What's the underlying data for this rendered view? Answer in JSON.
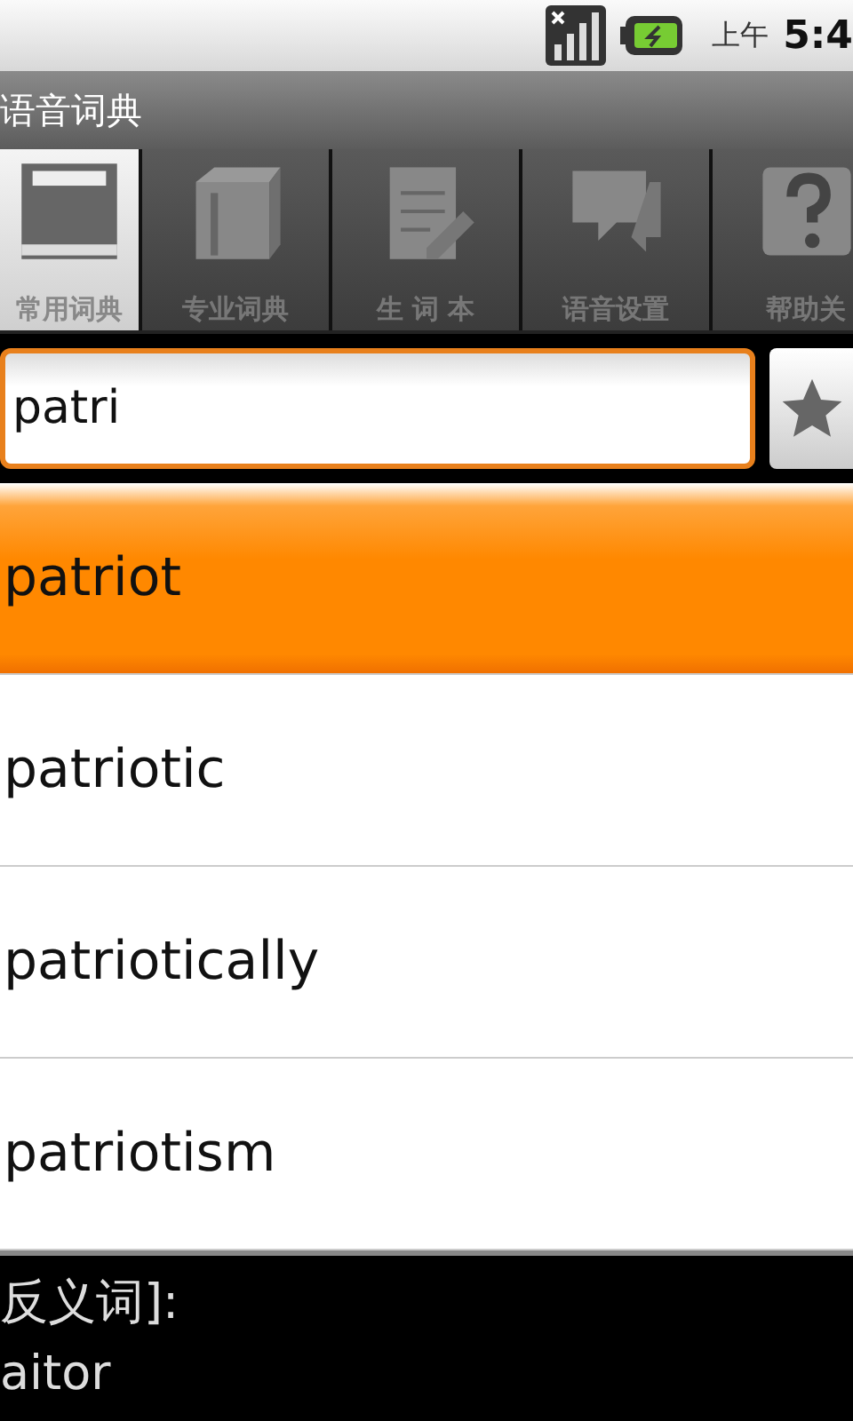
{
  "status_bar": {
    "time_prefix": "上午",
    "time": "5:4"
  },
  "window": {
    "title": "语音词典"
  },
  "tabs": [
    {
      "label": "常用词典",
      "selected": true,
      "kind": "window"
    },
    {
      "label": "专业词典",
      "selected": false,
      "kind": "books"
    },
    {
      "label": "生 词 本",
      "selected": false,
      "kind": "notepad"
    },
    {
      "label": "语音设置",
      "selected": false,
      "kind": "chat"
    },
    {
      "label": "帮助关",
      "selected": false,
      "kind": "help"
    }
  ],
  "search": {
    "value": "patri"
  },
  "results": [
    {
      "word": "patriot",
      "selected": true
    },
    {
      "word": "patriotic",
      "selected": false
    },
    {
      "word": "patriotically",
      "selected": false
    },
    {
      "word": "patriotism",
      "selected": false
    }
  ],
  "detail": {
    "heading": "反义词]:",
    "text": "aitor"
  }
}
